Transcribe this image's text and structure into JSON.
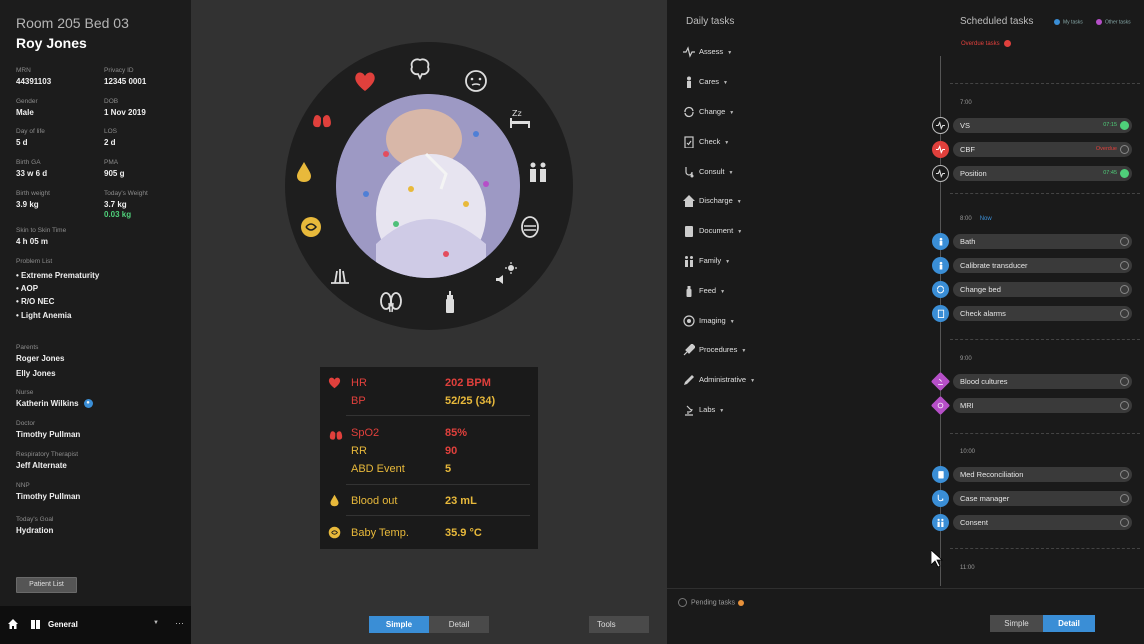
{
  "patient": {
    "room": "Room 205 Bed 03",
    "name": "Roy Jones",
    "fields": [
      {
        "label": "MRN",
        "value": "44391103"
      },
      {
        "label": "Privacy ID",
        "value": "12345 0001"
      },
      {
        "label": "Gender",
        "value": "Male"
      },
      {
        "label": "DOB",
        "value": "1 Nov 2019"
      },
      {
        "label": "Day of life",
        "value": "5 d"
      },
      {
        "label": "LOS",
        "value": "2 d"
      },
      {
        "label": "Birth GA",
        "value": "33 w 6 d"
      },
      {
        "label": "PMA",
        "value": "905 g"
      },
      {
        "label": "Birth weight",
        "value": "3.9 kg"
      },
      {
        "label": "Today's Weight",
        "value": "3.7 kg",
        "delta": "0.03 kg"
      },
      {
        "label": "Skin to Skin Time",
        "value": "4 h 05 m"
      }
    ],
    "problem_list_label": "Problem List",
    "problems": [
      "• Extreme Prematurity",
      "• AOP",
      "• R/O NEC",
      "• Light Anemia"
    ],
    "care_team": [
      {
        "label": "Parents",
        "value": "Roger Jones"
      },
      {
        "label": "",
        "value": "Elly Jones"
      },
      {
        "label": "Nurse",
        "value": "Katherin Wilkins"
      },
      {
        "label": "Doctor",
        "value": "Timothy Pullman"
      },
      {
        "label": "Respiratory Therapist",
        "value": "Jeff Alternate"
      },
      {
        "label": "NNP",
        "value": "Timothy Pullman"
      },
      {
        "label": "Today's Goal",
        "value": "Hydration"
      }
    ],
    "patient_list_button": "Patient List"
  },
  "bottombar": {
    "unit": "General"
  },
  "vitals": {
    "hr_label": "HR",
    "hr_value": "202 BPM",
    "bp_label": "BP",
    "bp_value": "52/25 (34)",
    "spo2_label": "SpO2",
    "spo2_value": "85%",
    "rr_label": "RR",
    "rr_value": "90",
    "abd_label": "ABD Event",
    "abd_value": "5",
    "blood_label": "Blood out",
    "blood_value": "23 mL",
    "temp_label": "Baby Temp.",
    "temp_value": "35.9 °C"
  },
  "center_tabs": {
    "simple": "Simple",
    "detail": "Detail",
    "tools": "Tools"
  },
  "daily_tasks": {
    "title": "Daily tasks",
    "items": [
      "Assess",
      "Cares",
      "Change",
      "Check",
      "Consult",
      "Discharge",
      "Document",
      "Family",
      "Feed",
      "Imaging",
      "Procedures",
      "Administrative",
      "Labs"
    ]
  },
  "scheduled": {
    "title": "Scheduled tasks",
    "legend_my": "My tasks",
    "legend_other": "Other tasks",
    "overdue": "Overdue tasks",
    "times": [
      "7:00",
      "8:00",
      "9:00",
      "10:00",
      "11:00"
    ],
    "now": "Now",
    "tasks": [
      {
        "name": "VS",
        "time": "07:15",
        "state": "done"
      },
      {
        "name": "CBF",
        "time": "Overdue",
        "state": "overdue"
      },
      {
        "name": "Position",
        "time": "07:45",
        "state": "done"
      },
      {
        "name": "Bath",
        "time": "",
        "state": "open"
      },
      {
        "name": "Calibrate transducer",
        "time": "",
        "state": "open"
      },
      {
        "name": "Change bed",
        "time": "",
        "state": "open"
      },
      {
        "name": "Check alarms",
        "time": "",
        "state": "open"
      },
      {
        "name": "Blood cultures",
        "time": "",
        "state": "open"
      },
      {
        "name": "MRI",
        "time": "",
        "state": "open"
      },
      {
        "name": "Med Reconciliation",
        "time": "",
        "state": "open"
      },
      {
        "name": "Case manager",
        "time": "",
        "state": "open"
      },
      {
        "name": "Consent",
        "time": "",
        "state": "open"
      }
    ],
    "pending": "Pending tasks"
  },
  "right_tabs": {
    "simple": "Simple",
    "detail": "Detail"
  },
  "colors": {
    "accent": "#3a8ed6",
    "alert": "#e0403c",
    "warning": "#e8b93b",
    "ok": "#4fd07a",
    "other": "#b64fc8"
  }
}
